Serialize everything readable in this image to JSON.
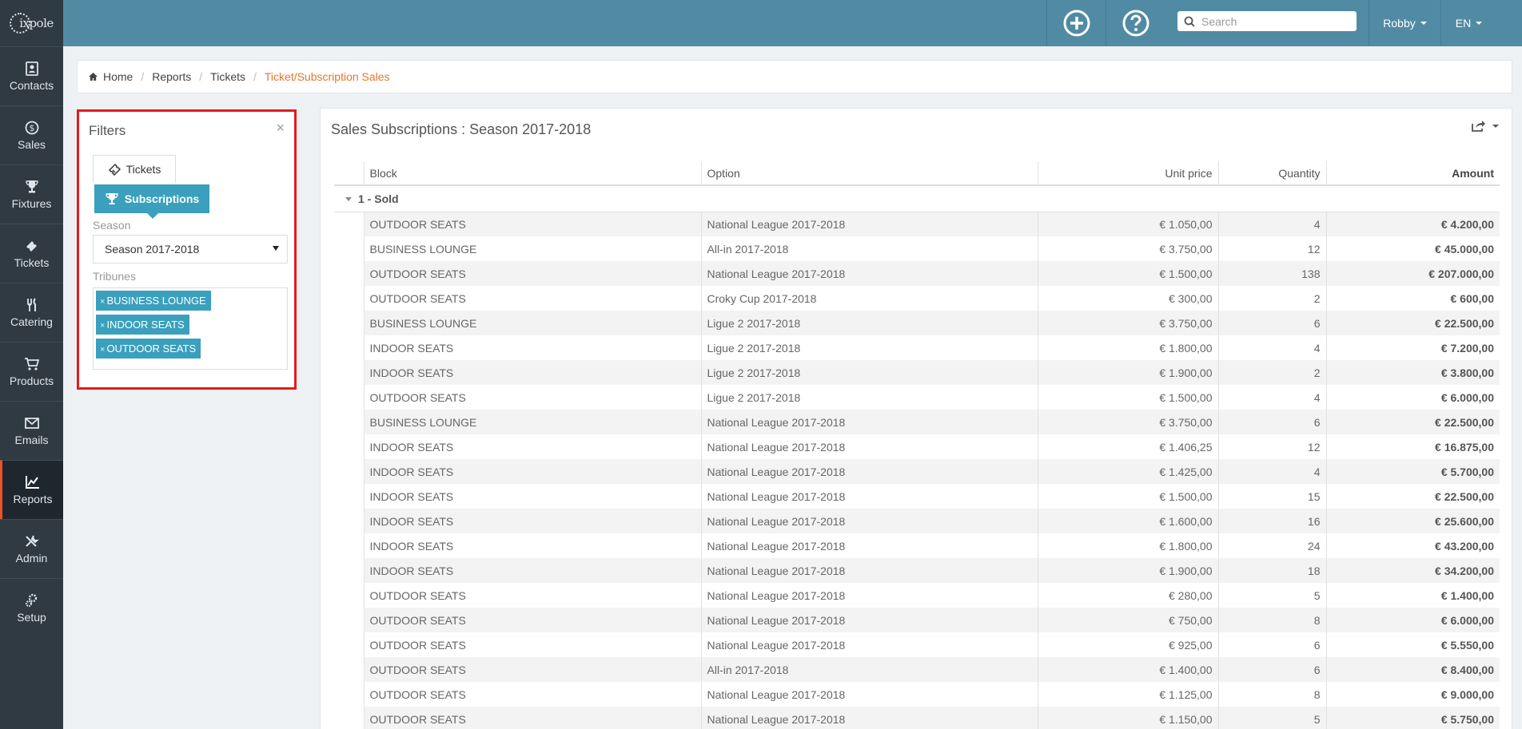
{
  "app": {
    "logo_text": "ixpole"
  },
  "sidebar": {
    "items": [
      {
        "label": "Contacts",
        "icon": "contacts-icon"
      },
      {
        "label": "Sales",
        "icon": "dollar-icon"
      },
      {
        "label": "Fixtures",
        "icon": "trophy-icon"
      },
      {
        "label": "Tickets",
        "icon": "ticket-icon"
      },
      {
        "label": "Catering",
        "icon": "utensils-icon"
      },
      {
        "label": "Products",
        "icon": "cart-icon"
      },
      {
        "label": "Emails",
        "icon": "envelope-icon"
      },
      {
        "label": "Reports",
        "icon": "chart-icon",
        "active": true
      },
      {
        "label": "Admin",
        "icon": "tools-icon"
      },
      {
        "label": "Setup",
        "icon": "gears-icon"
      }
    ]
  },
  "topbar": {
    "search_placeholder": "Search",
    "user": "Robby",
    "lang": "EN"
  },
  "breadcrumb": {
    "home": "Home",
    "reports": "Reports",
    "tickets": "Tickets",
    "current": "Ticket/Subscription Sales"
  },
  "filters": {
    "title": "Filters",
    "close": "×",
    "tab_tickets": "Tickets",
    "tab_subscriptions": "Subscriptions",
    "season_label": "Season",
    "season_value": "Season 2017-2018",
    "tribunes_label": "Tribunes",
    "tribunes": [
      "BUSINESS LOUNGE",
      "INDOOR SEATS",
      "OUTDOOR SEATS"
    ]
  },
  "report": {
    "title": "Sales Subscriptions : Season 2017-2018",
    "columns": {
      "block": "Block",
      "option": "Option",
      "unit_price": "Unit price",
      "quantity": "Quantity",
      "amount": "Amount"
    },
    "group": "1 - Sold",
    "rows": [
      [
        "OUTDOOR SEATS",
        "National League 2017-2018",
        "€ 1.050,00",
        "4",
        "€ 4.200,00"
      ],
      [
        "BUSINESS LOUNGE",
        "All-in 2017-2018",
        "€ 3.750,00",
        "12",
        "€ 45.000,00"
      ],
      [
        "OUTDOOR SEATS",
        "National League 2017-2018",
        "€ 1.500,00",
        "138",
        "€ 207.000,00"
      ],
      [
        "OUTDOOR SEATS",
        "Croky Cup 2017-2018",
        "€ 300,00",
        "2",
        "€ 600,00"
      ],
      [
        "BUSINESS LOUNGE",
        "Ligue 2 2017-2018",
        "€ 3.750,00",
        "6",
        "€ 22.500,00"
      ],
      [
        "INDOOR SEATS",
        "Ligue 2 2017-2018",
        "€ 1.800,00",
        "4",
        "€ 7.200,00"
      ],
      [
        "INDOOR SEATS",
        "Ligue 2 2017-2018",
        "€ 1.900,00",
        "2",
        "€ 3.800,00"
      ],
      [
        "OUTDOOR SEATS",
        "Ligue 2 2017-2018",
        "€ 1.500,00",
        "4",
        "€ 6.000,00"
      ],
      [
        "BUSINESS LOUNGE",
        "National League 2017-2018",
        "€ 3.750,00",
        "6",
        "€ 22.500,00"
      ],
      [
        "INDOOR SEATS",
        "National League 2017-2018",
        "€ 1.406,25",
        "12",
        "€ 16.875,00"
      ],
      [
        "INDOOR SEATS",
        "National League 2017-2018",
        "€ 1.425,00",
        "4",
        "€ 5.700,00"
      ],
      [
        "INDOOR SEATS",
        "National League 2017-2018",
        "€ 1.500,00",
        "15",
        "€ 22.500,00"
      ],
      [
        "INDOOR SEATS",
        "National League 2017-2018",
        "€ 1.600,00",
        "16",
        "€ 25.600,00"
      ],
      [
        "INDOOR SEATS",
        "National League 2017-2018",
        "€ 1.800,00",
        "24",
        "€ 43.200,00"
      ],
      [
        "INDOOR SEATS",
        "National League 2017-2018",
        "€ 1.900,00",
        "18",
        "€ 34.200,00"
      ],
      [
        "OUTDOOR SEATS",
        "National League 2017-2018",
        "€ 280,00",
        "5",
        "€ 1.400,00"
      ],
      [
        "OUTDOOR SEATS",
        "National League 2017-2018",
        "€ 750,00",
        "8",
        "€ 6.000,00"
      ],
      [
        "OUTDOOR SEATS",
        "National League 2017-2018",
        "€ 925,00",
        "6",
        "€ 5.550,00"
      ],
      [
        "OUTDOOR SEATS",
        "All-in 2017-2018",
        "€ 1.400,00",
        "6",
        "€ 8.400,00"
      ],
      [
        "OUTDOOR SEATS",
        "National League 2017-2018",
        "€ 1.125,00",
        "8",
        "€ 9.000,00"
      ],
      [
        "OUTDOOR SEATS",
        "National League 2017-2018",
        "€ 1.150,00",
        "5",
        "€ 5.750,00"
      ]
    ]
  },
  "colors": {
    "topbar": "#518ba3",
    "sidebar": "#2f3a43",
    "accent": "#3aa0bd",
    "highlight_border": "#e31b1b",
    "breadcrumb_current": "#e8742c"
  }
}
